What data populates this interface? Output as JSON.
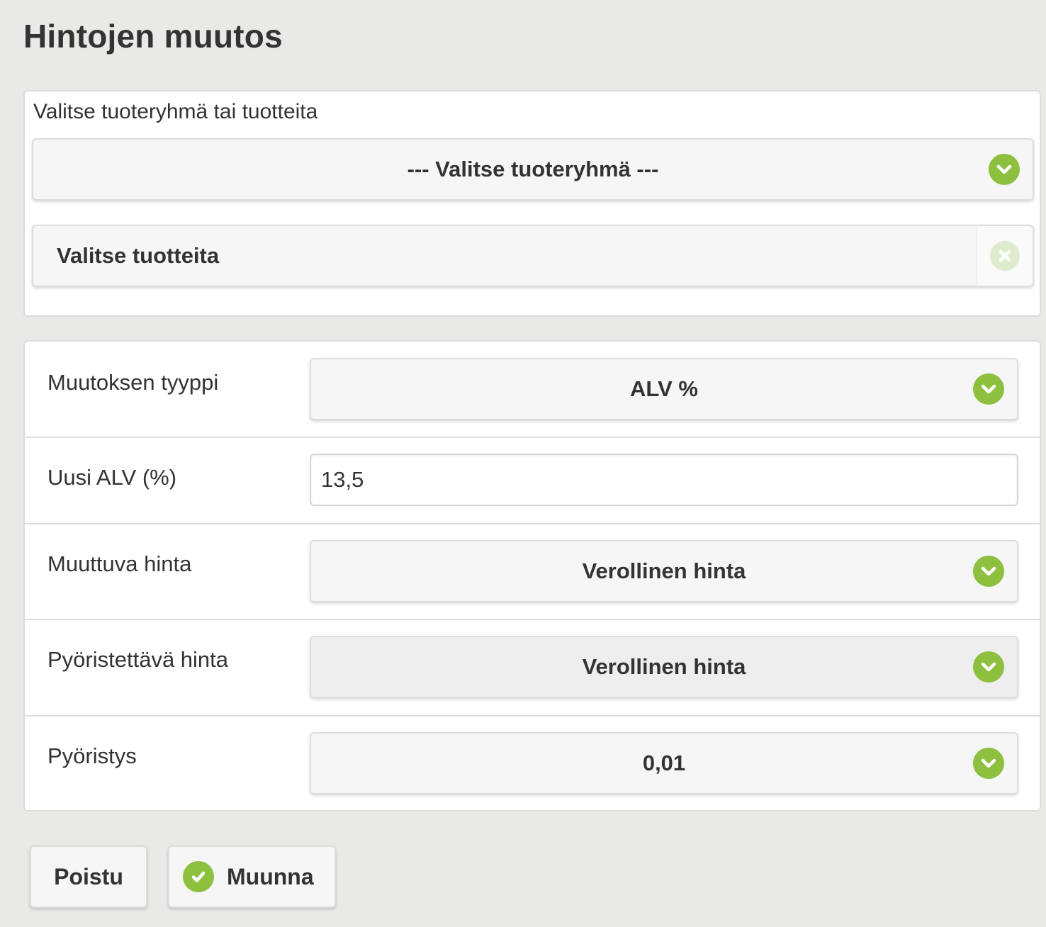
{
  "page": {
    "title": "Hintojen muutos"
  },
  "selection": {
    "legend": "Valitse tuoteryhmä tai tuotteita",
    "group_select": "--- Valitse tuoteryhmä ---",
    "product_select": "Valitse tuotteita"
  },
  "form": {
    "change_type": {
      "label": "Muutoksen tyyppi",
      "value": "ALV %"
    },
    "new_vat": {
      "label": "Uusi ALV (%)",
      "value": "13,5"
    },
    "changing_price": {
      "label": "Muuttuva hinta",
      "value": "Verollinen hinta"
    },
    "rounded_price": {
      "label": "Pyöristettävä hinta",
      "value": "Verollinen hinta"
    },
    "rounding": {
      "label": "Pyöristys",
      "value": "0,01"
    }
  },
  "footer": {
    "exit_label": "Poistu",
    "convert_label": "Muunna"
  },
  "colors": {
    "accent": "#8dc03f",
    "background": "#e9e9e7"
  }
}
